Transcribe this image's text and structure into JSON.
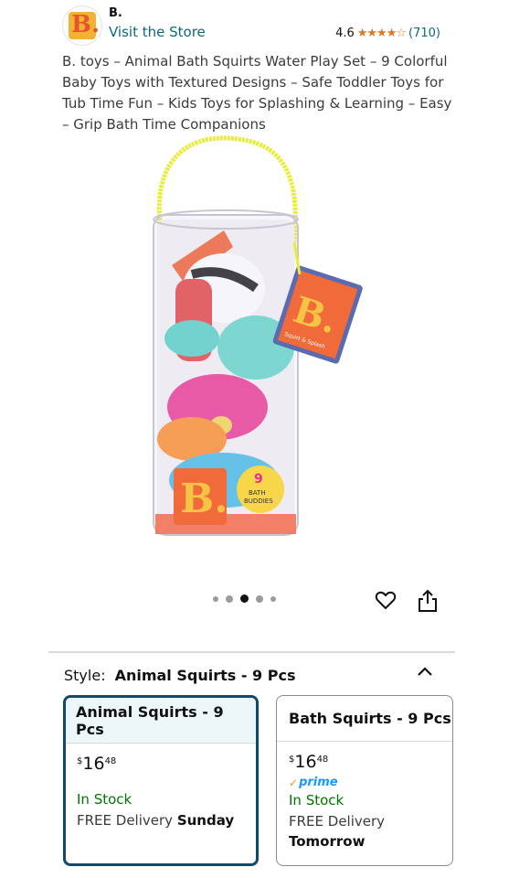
{
  "seller": {
    "logo_letter": "B.",
    "name": "B.",
    "visit_link": "Visit the Store",
    "rating_value": "4.6",
    "stars": "★★★★☆",
    "rating_count": "(710)"
  },
  "product": {
    "title": "B. toys – Animal Bath Squirts Water Play Set – 9 Colorful Baby Toys with Textured Designs – Safe Toddler Toys for Tub Time Fun – Kids Toys for Splashing & Learning – Easy – Grip Bath Time Companions",
    "image_label": "B.",
    "tag_label": "B.",
    "tag_sub": "Squirt & Splash",
    "badge_count": "9",
    "badge_text_1": "BATH",
    "badge_text_2": "BUDDIES"
  },
  "carousel": {
    "total": 5,
    "active_index": 3
  },
  "style": {
    "label": "Style:",
    "selected": "Animal Squirts - 9 Pcs"
  },
  "options": [
    {
      "name": "Animal Squirts - 9 Pcs",
      "price_symbol": "$",
      "price_whole": "16",
      "price_fraction": "48",
      "stock": "In Stock",
      "delivery_prefix": "FREE Delivery",
      "delivery_day": "Sunday"
    },
    {
      "name": "Bath Squirts - 9 Pcs",
      "price_symbol": "$",
      "price_whole": "16",
      "price_fraction": "48",
      "prime": "prime",
      "stock": "In Stock",
      "delivery_prefix": "FREE Delivery",
      "delivery_day": "Tomorrow"
    }
  ],
  "colors": {
    "link": "#0b6b7a",
    "star": "#de7921",
    "in_stock": "#007600",
    "selected_border": "#12486b",
    "prime": "#1a98ff"
  }
}
